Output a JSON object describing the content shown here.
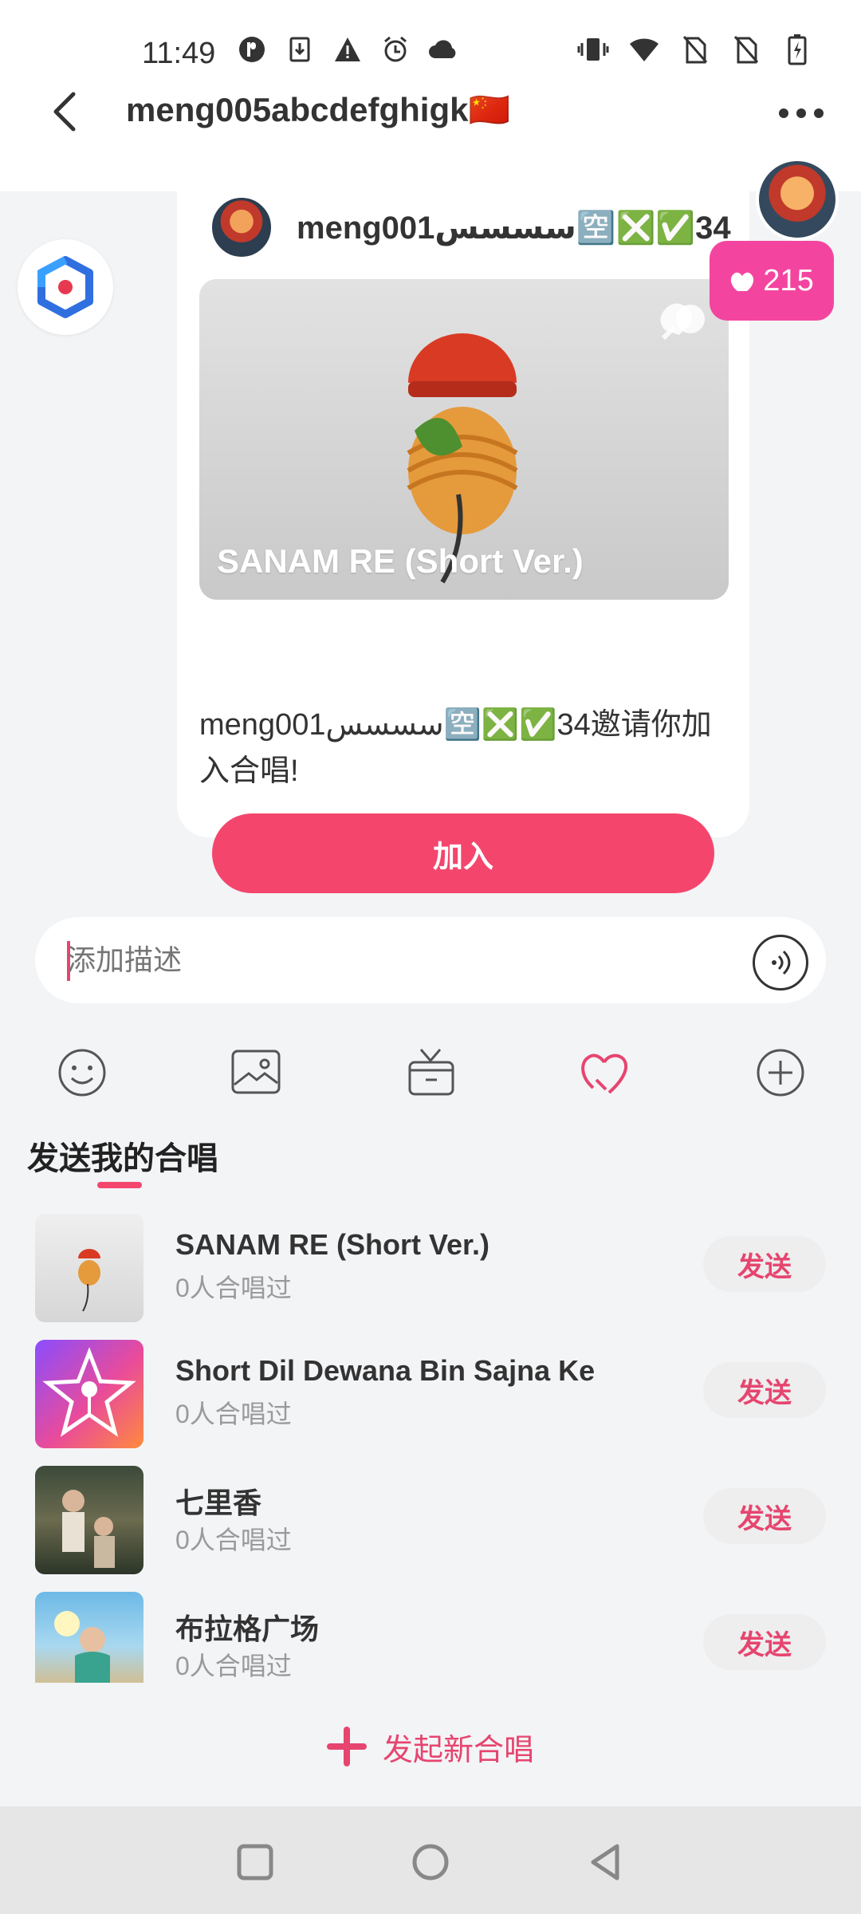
{
  "status_bar": {
    "time": "11:49",
    "icons_left": [
      "p-icon",
      "download-icon",
      "warning-icon",
      "alarm-icon",
      "cloud-icon"
    ],
    "icons_right": [
      "vibrate-icon",
      "wifi-icon",
      "no-sim-icon",
      "no-sim-icon",
      "battery-charging-icon"
    ]
  },
  "header": {
    "title": "meng005abcdefghigk🇨🇳"
  },
  "invite_card": {
    "sender_name": "meng001سسسس🈳❎✅34",
    "media_title": "SANAM RE (Short Ver.)",
    "invite_text": "meng001سسسس🈳❎✅34邀请你加入合唱!",
    "join_label": "加入",
    "likes_count": "215"
  },
  "input": {
    "placeholder": "添加描述"
  },
  "tools": [
    "emoji-icon",
    "image-icon",
    "gift-icon",
    "chorus-icon",
    "plus-icon"
  ],
  "panel": {
    "title": "发送我的合唱",
    "songs": [
      {
        "title": "SANAM RE (Short Ver.)",
        "subtitle": "0人合唱过",
        "send_label": "发送"
      },
      {
        "title": "Short Dil Dewana Bin Sajna Ke",
        "subtitle": "0人合唱过",
        "send_label": "发送"
      },
      {
        "title": "七里香",
        "subtitle": "0人合唱过",
        "send_label": "发送"
      },
      {
        "title": "布拉格广场",
        "subtitle": "0人合唱过",
        "send_label": "发送"
      }
    ],
    "new_chorus_label": "发起新合唱"
  },
  "colors": {
    "accent": "#f4466d",
    "likes_badge": "#f3459f",
    "background": "#f3f4f6"
  }
}
